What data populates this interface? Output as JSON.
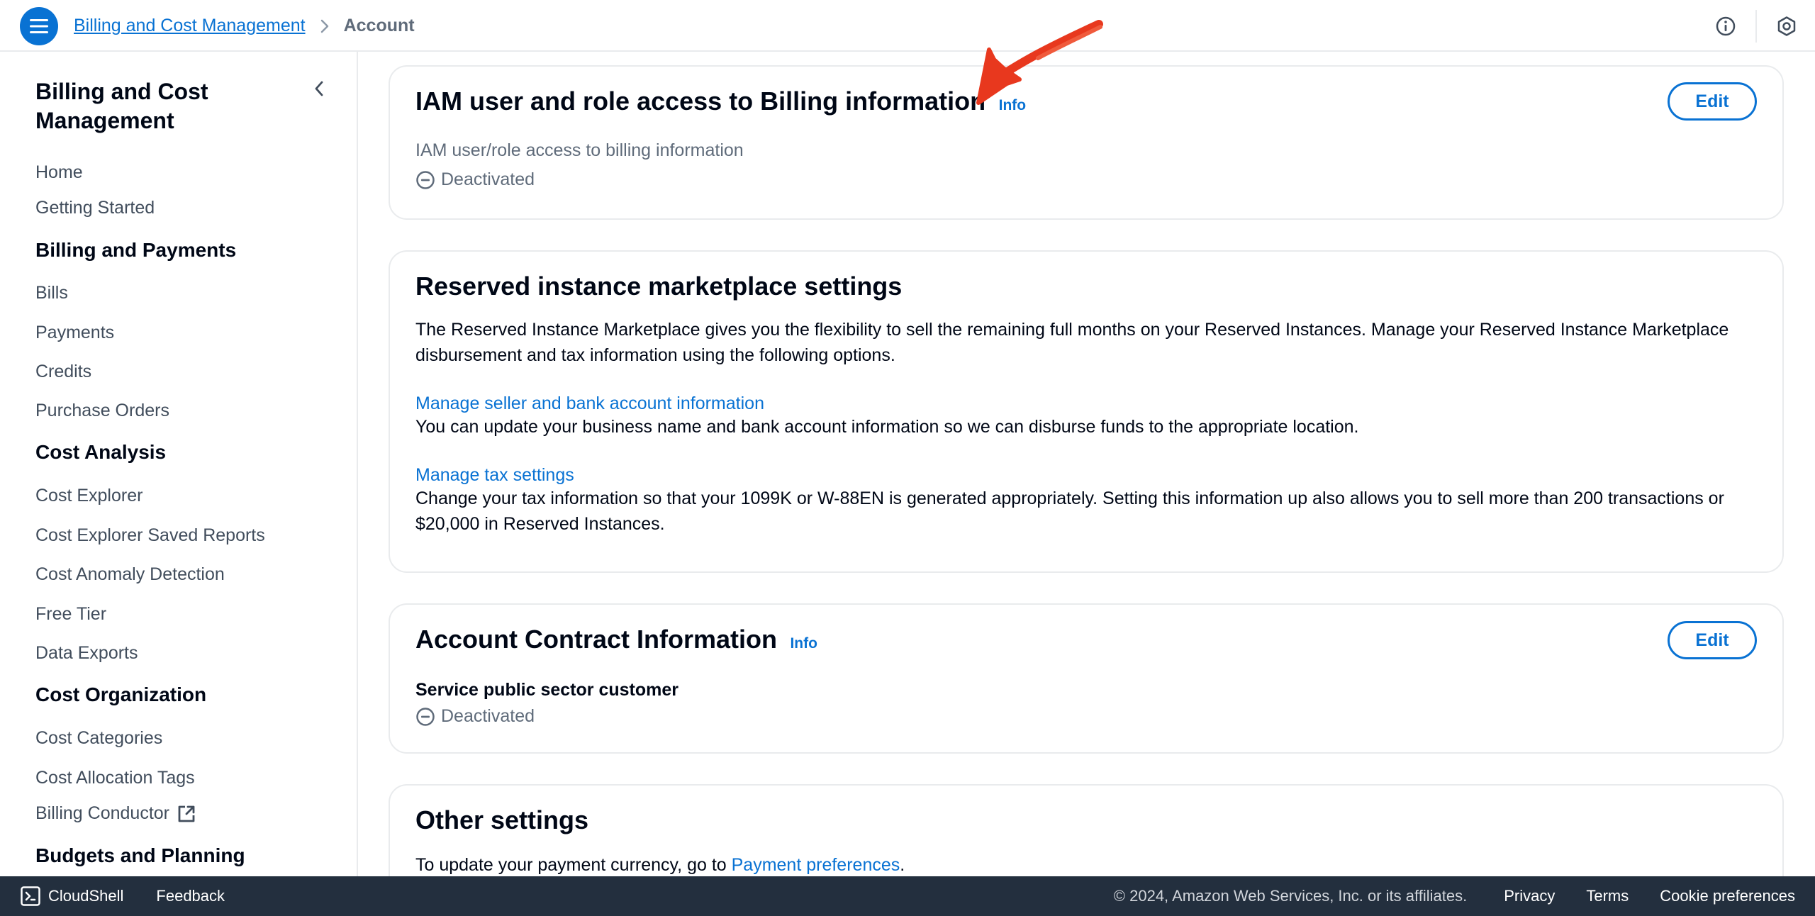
{
  "breadcrumb": {
    "parent": "Billing and Cost Management",
    "current": "Account"
  },
  "sidebar": {
    "title": "Billing and Cost Management",
    "items": [
      {
        "type": "link",
        "label": "Home"
      },
      {
        "type": "link",
        "label": "Getting Started"
      },
      {
        "type": "heading",
        "label": "Billing and Payments"
      },
      {
        "type": "link",
        "label": "Bills"
      },
      {
        "type": "link",
        "label": "Payments"
      },
      {
        "type": "link",
        "label": "Credits"
      },
      {
        "type": "link",
        "label": "Purchase Orders"
      },
      {
        "type": "heading",
        "label": "Cost Analysis"
      },
      {
        "type": "link",
        "label": "Cost Explorer"
      },
      {
        "type": "link",
        "label": "Cost Explorer Saved Reports"
      },
      {
        "type": "link",
        "label": "Cost Anomaly Detection"
      },
      {
        "type": "link",
        "label": "Free Tier"
      },
      {
        "type": "link",
        "label": "Data Exports"
      },
      {
        "type": "heading",
        "label": "Cost Organization"
      },
      {
        "type": "link",
        "label": "Cost Categories"
      },
      {
        "type": "link",
        "label": "Cost Allocation Tags"
      },
      {
        "type": "link",
        "label": "Billing Conductor",
        "external": true
      },
      {
        "type": "heading",
        "label": "Budgets and Planning"
      }
    ]
  },
  "iam_card": {
    "title": "IAM user and role access to Billing information",
    "info": "Info",
    "edit": "Edit",
    "field_label": "IAM user/role access to billing information",
    "status": "Deactivated"
  },
  "ri_card": {
    "title": "Reserved instance marketplace settings",
    "description": "The Reserved Instance Marketplace gives you the flexibility to sell the remaining full months on your Reserved Instances. Manage your Reserved Instance Marketplace disbursement and tax information using the following options.",
    "seller_link": "Manage seller and bank account information",
    "seller_desc": "You can update your business name and bank account information so we can disburse funds to the appropriate location.",
    "tax_link": "Manage tax settings",
    "tax_desc": "Change your tax information so that your 1099K or W-88EN is generated appropriately. Setting this information up also allows you to sell more than 200 transactions or $20,000 in Reserved Instances."
  },
  "contract_card": {
    "title": "Account Contract Information",
    "info": "Info",
    "edit": "Edit",
    "field_label": "Service public sector customer",
    "status": "Deactivated"
  },
  "other_card": {
    "title": "Other settings",
    "text_before": "To update your payment currency, go to ",
    "link": "Payment preferences",
    "text_after": "."
  },
  "footer": {
    "cloudshell": "CloudShell",
    "feedback": "Feedback",
    "copyright": "© 2024, Amazon Web Services, Inc. or its affiliates.",
    "privacy": "Privacy",
    "terms": "Terms",
    "cookie": "Cookie preferences"
  },
  "colors": {
    "accent": "#0972d3",
    "annotation_arrow": "#e8381e",
    "footer_bg": "#232f3e"
  }
}
